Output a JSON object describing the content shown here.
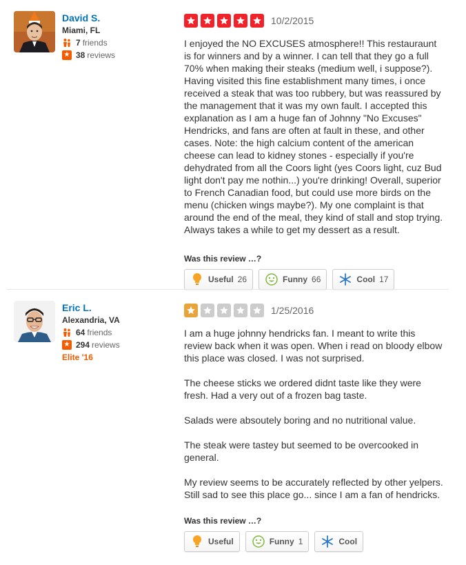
{
  "colors": {
    "star_filled_5": "#f0232b",
    "star_filled_1": "#e8a33b",
    "star_empty": "#cccccc",
    "user_link": "#0073bb",
    "elite": "#f15c00"
  },
  "reviews": [
    {
      "user": {
        "name": "David S.",
        "location": "Miami, FL",
        "friends_count": "7",
        "friends_label": "friends",
        "reviews_count": "38",
        "reviews_label": "reviews",
        "elite": ""
      },
      "rating": 5,
      "date": "10/2/2015",
      "text": "I enjoyed the NO EXCUSES atmosphere!! This restauraunt is for winners and by a winner. I can tell that they go a full 70% when making their steaks (medium well, i suppose?). Having visited this fine establishment many times, i once received a steak that was too rubbery, but was reassured by the management that it was my own fault. I accepted this explanation as I am a huge fan of Johnny \"No Excuses\" Hendricks, and fans are often at fault in these, and other cases. Note: the high calcium content of the american cheese can lead to kidney stones - especially if you're dehydrated from all the Coors light (yes Coors light, cuz Bud light don't pay me nothin...) you're drinking! Overall, superior to French Canadian food, but could use more birds on the menu (chicken wings maybe?). My one complaint is that around the end of the meal, they kind of stall and stop trying. Always takes a while to get my dessert as a result.",
      "helpful_label": "Was this review …?",
      "votes": {
        "useful": {
          "label": "Useful",
          "count": "26"
        },
        "funny": {
          "label": "Funny",
          "count": "66"
        },
        "cool": {
          "label": "Cool",
          "count": "17"
        }
      }
    },
    {
      "user": {
        "name": "Eric L.",
        "location": "Alexandria, VA",
        "friends_count": "64",
        "friends_label": "friends",
        "reviews_count": "294",
        "reviews_label": "reviews",
        "elite": "Elite '16"
      },
      "rating": 1,
      "date": "1/25/2016",
      "text": "I am a huge johnny hendricks fan. I meant to write this review back when it was open. When i read on bloody elbow this place was closed. I was not surprised.\n\nThe cheese sticks we ordered didnt taste like they were fresh.  Had a very out of a frozen bag taste.\n\nSalads were absoutely boring and no nutritional value.\n\nThe steak were tastey but seemed to be overcooked in general.\n\nMy review seems to be accurately reflected by other yelpers. Still sad to see this place go... since I am a fan of hendricks.",
      "helpful_label": "Was this review …?",
      "votes": {
        "useful": {
          "label": "Useful",
          "count": ""
        },
        "funny": {
          "label": "Funny",
          "count": "1"
        },
        "cool": {
          "label": "Cool",
          "count": ""
        }
      }
    }
  ]
}
